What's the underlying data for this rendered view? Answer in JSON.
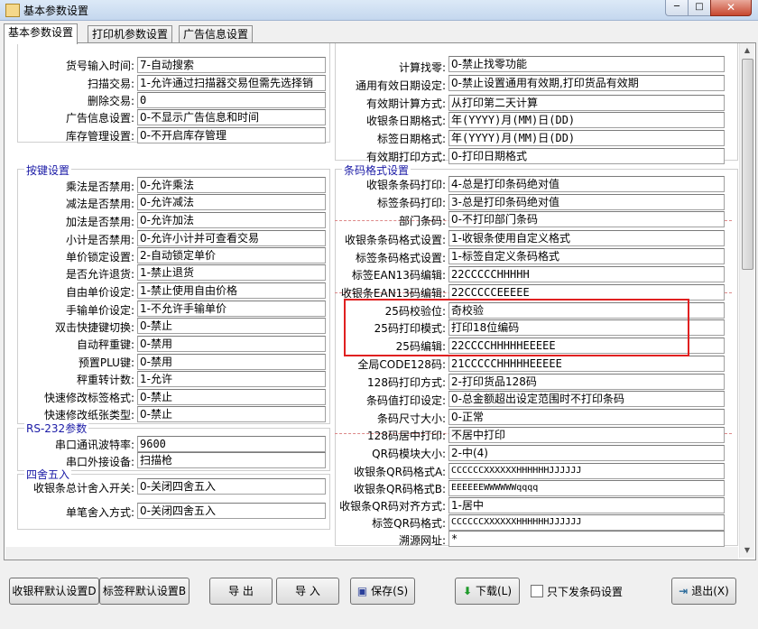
{
  "window": {
    "title": "基本参数设置",
    "min": "─",
    "max": "□",
    "close": "✕"
  },
  "tabs": [
    "基本参数设置",
    "打印机参数设置",
    "广告信息设置"
  ],
  "left": {
    "top_rows": [
      {
        "label": "货号输入时间:",
        "value": "7-自动搜索"
      },
      {
        "label": "扫描交易:",
        "value": "1-允许通过扫描器交易但需先选择销"
      },
      {
        "label": "删除交易:",
        "value": "0"
      },
      {
        "label": "广告信息设置:",
        "value": "0-不显示广告信息和时间"
      },
      {
        "label": "库存管理设置:",
        "value": "0-不开启库存管理"
      }
    ],
    "keys_group": {
      "title": "按键设置",
      "rows": [
        {
          "label": "乘法是否禁用:",
          "value": "0-允许乘法"
        },
        {
          "label": "减法是否禁用:",
          "value": "0-允许减法"
        },
        {
          "label": "加法是否禁用:",
          "value": "0-允许加法"
        },
        {
          "label": "小计是否禁用:",
          "value": "0-允许小计并可查看交易"
        },
        {
          "label": "单价锁定设置:",
          "value": "2-自动锁定单价"
        },
        {
          "label": "是否允许退货:",
          "value": "1-禁止退货"
        },
        {
          "label": "自由单价设定:",
          "value": "1-禁止使用自由价格"
        },
        {
          "label": "手输单价设定:",
          "value": "1-不允许手输单价"
        },
        {
          "label": "双击快捷键切换:",
          "value": "0-禁止"
        },
        {
          "label": "自动秤重键:",
          "value": "0-禁用"
        },
        {
          "label": "预置PLU键:",
          "value": "0-禁用"
        },
        {
          "label": "秤重转计数:",
          "value": "1-允许"
        },
        {
          "label": "快速修改标签格式:",
          "value": "0-禁止"
        },
        {
          "label": "快速修改纸张类型:",
          "value": "0-禁止"
        }
      ]
    },
    "rs232_group": {
      "title": "RS-232参数",
      "rows": [
        {
          "label": "串口通讯波特率:",
          "value": "9600"
        },
        {
          "label": "串口外接设备:",
          "value": "扫描枪"
        }
      ]
    },
    "round_group": {
      "title": "四舍五入",
      "rows": [
        {
          "label": "收银条总计舍入开关:",
          "value": "0-关闭四舍五入"
        },
        {
          "label": "单笔舍入方式:",
          "value": "0-关闭四舍五入"
        }
      ]
    }
  },
  "right": {
    "top_rows": [
      {
        "label": "计算找零:",
        "value": "0-禁止找零功能"
      },
      {
        "label": "通用有效日期设定:",
        "value": "0-禁止设置通用有效期,打印货品有效期"
      },
      {
        "label": "有效期计算方式:",
        "value": "从打印第二天计算"
      },
      {
        "label": "收银条日期格式:",
        "value": "年(YYYY)月(MM)日(DD)"
      },
      {
        "label": "标签日期格式:",
        "value": "年(YYYY)月(MM)日(DD)"
      },
      {
        "label": "有效期打印方式:",
        "value": "0-打印日期格式"
      }
    ],
    "barcode_group": {
      "title": "条码格式设置",
      "rows": [
        {
          "label": "收银条条码打印:",
          "value": "4-总是打印条码绝对值"
        },
        {
          "label": "标签条码打印:",
          "value": "3-总是打印条码绝对值"
        },
        {
          "label": "部门条码:",
          "value": "0-不打印部门条码"
        },
        {
          "label": "收银条条码格式设置:",
          "value": "1-收银条使用自定义格式"
        },
        {
          "label": "标签条码格式设置:",
          "value": "1-标签自定义条码格式"
        },
        {
          "label": "标签EAN13码编辑:",
          "value": "22CCCCCHHHHH"
        },
        {
          "label": "收银条EAN13码编辑:",
          "value": "22CCCCCEEEEE"
        },
        {
          "label": "25码校验位:",
          "value": "奇校验"
        },
        {
          "label": "25码打印模式:",
          "value": "打印18位编码"
        },
        {
          "label": "25码编辑:",
          "value": "22CCCCHHHHHEEEEE"
        },
        {
          "label": "全局CODE128码:",
          "value": "21CCCCCHHHHHEEEEE"
        },
        {
          "label": "128码打印方式:",
          "value": "2-打印货品128码"
        },
        {
          "label": "条码值打印设定:",
          "value": "0-总金额超出设定范围时不打印条码"
        },
        {
          "label": "条码尺寸大小:",
          "value": "0-正常"
        },
        {
          "label": "128码居中打印:",
          "value": "不居中打印"
        },
        {
          "label": "QR码模块大小:",
          "value": "2-中(4)"
        },
        {
          "label": "收银条QR码格式A:",
          "value": "CCCCCCXXXXXXHHHHHHJJJJJJ"
        },
        {
          "label": "收银条QR码格式B:",
          "value": "EEEEEEWWWWWWqqqq"
        },
        {
          "label": "收银条QR码对齐方式:",
          "value": "1-居中"
        },
        {
          "label": "标签QR码格式:",
          "value": "CCCCCCXXXXXXHHHHHHJJJJJJ"
        },
        {
          "label": "溯源网址:",
          "value": "*"
        }
      ]
    }
  },
  "buttons": {
    "cashier_default": "收银秤默认设置D",
    "label_default": "标签秤默认设置B",
    "export": "导 出",
    "import": "导 入",
    "save": "保存(S)",
    "download": "下载(L)",
    "only_barcode": "只下发条码设置",
    "exit": "退出(X)"
  },
  "colors": {
    "accent_group_title": "#1a1aa6",
    "highlight_box": "#e02020"
  }
}
